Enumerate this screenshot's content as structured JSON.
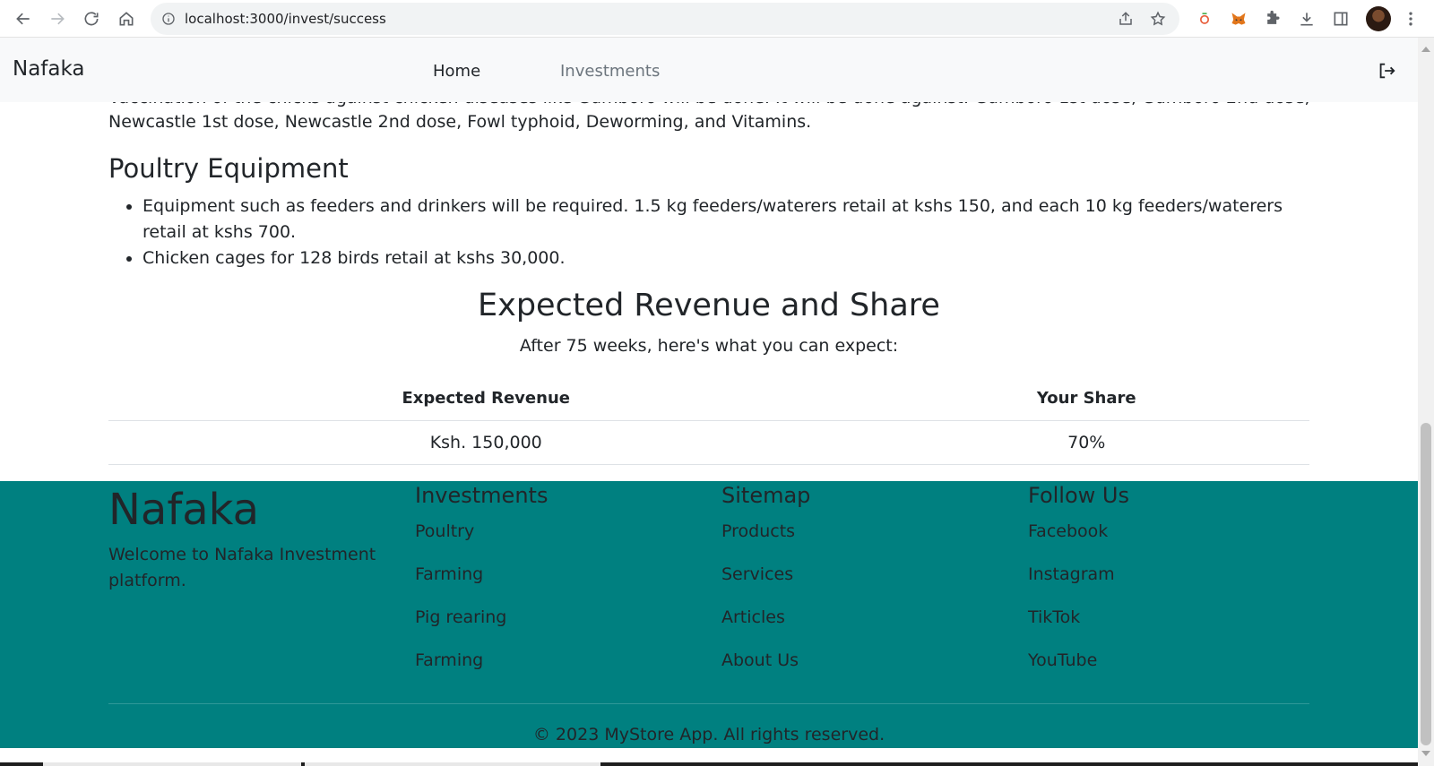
{
  "browser": {
    "url": "localhost:3000/invest/success",
    "icons": [
      "back-icon",
      "forward-icon",
      "reload-icon",
      "home-icon",
      "info-icon",
      "share-icon",
      "star-icon",
      "extension-1-icon",
      "metamask-fox-icon",
      "puzzle-icon",
      "download-icon",
      "sidepanel-icon",
      "avatar",
      "menu-dots-icon"
    ]
  },
  "nav": {
    "brand": "Nafaka",
    "home": "Home",
    "investments": "Investments"
  },
  "content": {
    "cut_line": "Vaccination of the chicks against chicken diseases like Gumboro will be done. It will be done against: Gumboro 1st dose, Gumboro 2nd dose,",
    "para": "Newcastle 1st dose, Newcastle 2nd dose, Fowl typhoid, Deworming, and Vitamins.",
    "equipment_heading": "Poultry Equipment",
    "bullets": [
      "Equipment such as feeders and drinkers will be required. 1.5 kg feeders/waterers retail at kshs 150, and each 10 kg feeders/waterers retail at kshs 700.",
      "Chicken cages for 128 birds retail at kshs 30,000."
    ],
    "revenue_heading": "Expected Revenue and Share",
    "revenue_sub": "After 75 weeks, here's what you can expect:",
    "table": {
      "headers": [
        "Expected Revenue",
        "Your Share"
      ],
      "row": [
        "Ksh. 150,000",
        "70%"
      ]
    }
  },
  "footer": {
    "brand": "Nafaka",
    "welcome": "Welcome to Nafaka Investment platform.",
    "columns": [
      {
        "title": "Investments",
        "items": [
          "Poultry",
          "Farming",
          "Pig rearing",
          "Farming"
        ]
      },
      {
        "title": "Sitemap",
        "items": [
          "Products",
          "Services",
          "Articles",
          "About Us"
        ]
      },
      {
        "title": "Follow Us",
        "items": [
          "Facebook",
          "Instagram",
          "TikTok",
          "YouTube"
        ]
      }
    ],
    "copyright": "© 2023 MyStore App. All rights reserved.",
    "bg_color": "#008080"
  }
}
